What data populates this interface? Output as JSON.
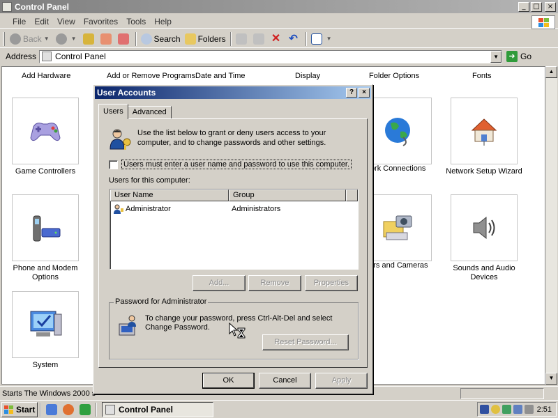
{
  "window": {
    "title": "Control Panel",
    "controls": {
      "minimize": "_",
      "maximize": "□",
      "close": "×"
    }
  },
  "menubar": {
    "items": [
      "File",
      "Edit",
      "View",
      "Favorites",
      "Tools",
      "Help"
    ]
  },
  "toolbar": {
    "back": "Back",
    "search": "Search",
    "folders": "Folders"
  },
  "addressbar": {
    "label": "Address",
    "value": "Control Panel",
    "go": "Go"
  },
  "control_panel": {
    "top_row": [
      "Add Hardware",
      "Add or Remove Programs",
      "Date and Time",
      "Display",
      "Folder Options",
      "Fonts"
    ],
    "items": {
      "game_controllers": "Game Controllers",
      "phone_modem": "Phone and Modem Options",
      "system": "System",
      "network_connections": "work Connections",
      "network_setup": "Network Setup Wizard",
      "scanners": "ners and Cameras",
      "sounds": "Sounds and Audio Devices"
    }
  },
  "statusbar": {
    "text": "Starts The Windows 2000 s"
  },
  "taskbar": {
    "start": "Start",
    "task": "Control Panel",
    "clock": "2:51"
  },
  "dialog": {
    "title": "User Accounts",
    "help": "?",
    "close": "×",
    "tabs": [
      "Users",
      "Advanced"
    ],
    "intro": "Use the list below to grant or deny users access to your computer, and to change passwords and other settings.",
    "checkbox_label": "Users must enter a user name and password to use this computer.",
    "users_label": "Users for this computer:",
    "columns": [
      "User Name",
      "Group"
    ],
    "rows": [
      {
        "user": "Administrator",
        "group": "Administrators"
      }
    ],
    "buttons": {
      "add": "Add...",
      "remove": "Remove",
      "properties": "Properties"
    },
    "password_group": "Password for Administrator",
    "password_text": "To change your password, press Ctrl-Alt-Del and select Change Password.",
    "reset_password": "Reset Password...",
    "ok": "OK",
    "cancel": "Cancel",
    "apply": "Apply"
  }
}
